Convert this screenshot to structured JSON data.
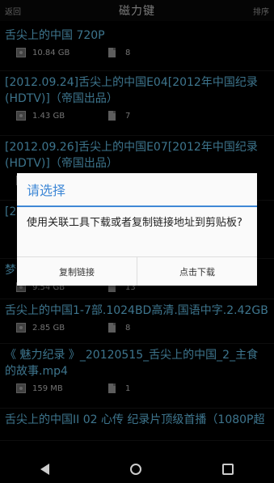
{
  "header": {
    "back_label": "返回",
    "title": "磁力键",
    "sort_label": "排序"
  },
  "items": [
    {
      "name": "舌尖上的中国 720P",
      "size": "10.84 GB",
      "files": "8"
    },
    {
      "name": "[2012.09.24]舌尖上的中国E04[2012年中国纪录(HDTV)]（帝国出品）",
      "size": "1.43 GB",
      "files": "7"
    },
    {
      "name": "[2012.09.26]舌尖上的中国E07[2012年中国纪录(HDTV)]（帝国出品）",
      "size": "",
      "files": ""
    },
    {
      "name": "[2",
      "size": "",
      "files": ""
    },
    {
      "name": "梦",
      "size": "9.54 GB",
      "files": "13"
    },
    {
      "name": "舌尖上的中国1-7部.1024BD高清.国语中字.2.42GB",
      "size": "2.85 GB",
      "files": "8"
    },
    {
      "name": "《 魅力纪录 》_20120515_舌尖上的中国_2_主食的故事.mp4",
      "size": "159 MB",
      "files": "1"
    },
    {
      "name": "舌尖上的中国II 02 心传 纪录片顶级首播（1080P超",
      "size": "",
      "files": ""
    }
  ],
  "dialog": {
    "title": "请选择",
    "message": "使用关联工具下载或者复制链接地址到剪贴板?",
    "copy_label": "复制链接",
    "download_label": "点击下载",
    "accent": "#3f88d6"
  },
  "navbar": {
    "back_icon": "back-triangle-icon",
    "home_icon": "home-circle-icon",
    "recent_icon": "recent-square-icon"
  }
}
